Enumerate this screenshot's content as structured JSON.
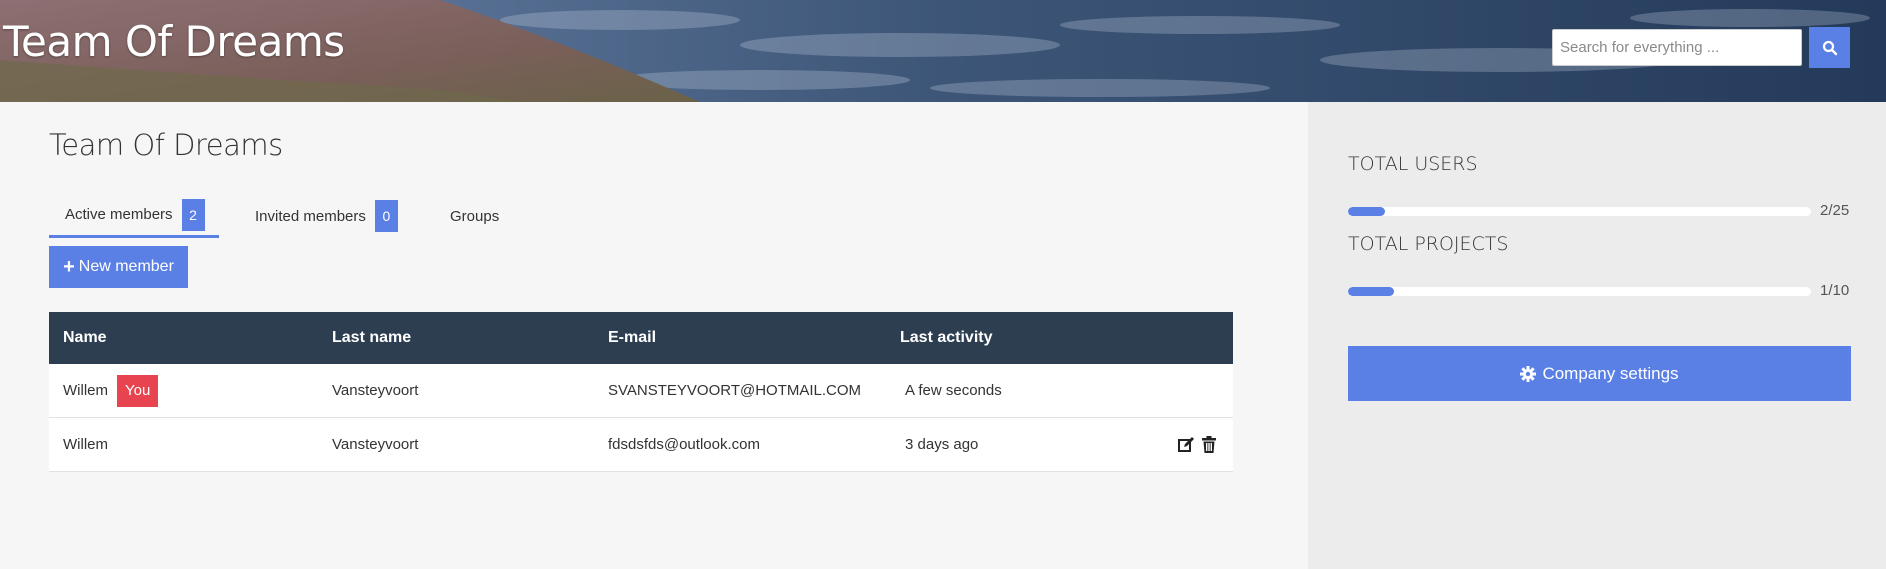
{
  "header": {
    "title": "Team Of Dreams",
    "search": {
      "placeholder": "Search for everything ...",
      "value": ""
    },
    "search_icon": "search-icon"
  },
  "main": {
    "title": "Team Of Dreams",
    "tabs": [
      {
        "label": "Active members",
        "count": "2",
        "active": true
      },
      {
        "label": "Invited members",
        "count": "0",
        "active": false
      },
      {
        "label": "Groups",
        "active": false
      }
    ],
    "new_member_label": "New member",
    "table": {
      "headers": [
        "Name",
        "Last name",
        "E-mail",
        "Last activity"
      ],
      "rows": [
        {
          "name": "Willem",
          "badge": "You",
          "last_name": "Vansteyvoort",
          "email": "SVANSTEYVOORT@HOTMAIL.COM",
          "activity": "A few seconds"
        },
        {
          "name": "Willem",
          "last_name": "Vansteyvoort",
          "email": "fdsdsfds@outlook.com",
          "activity": "3 days ago",
          "actions": [
            "edit-icon",
            "trash-icon"
          ]
        }
      ]
    }
  },
  "sidebar": {
    "users": {
      "title": "TOTAL USERS",
      "label": "2/25",
      "fraction": 0.08
    },
    "projects": {
      "title": "TOTAL PROJECTS",
      "label": "1/10",
      "fraction": 0.1
    },
    "company_settings_label": "Company settings"
  },
  "colors": {
    "accent": "#5a80e6",
    "header_dark": "#2c3e50",
    "danger": "#e84450"
  }
}
